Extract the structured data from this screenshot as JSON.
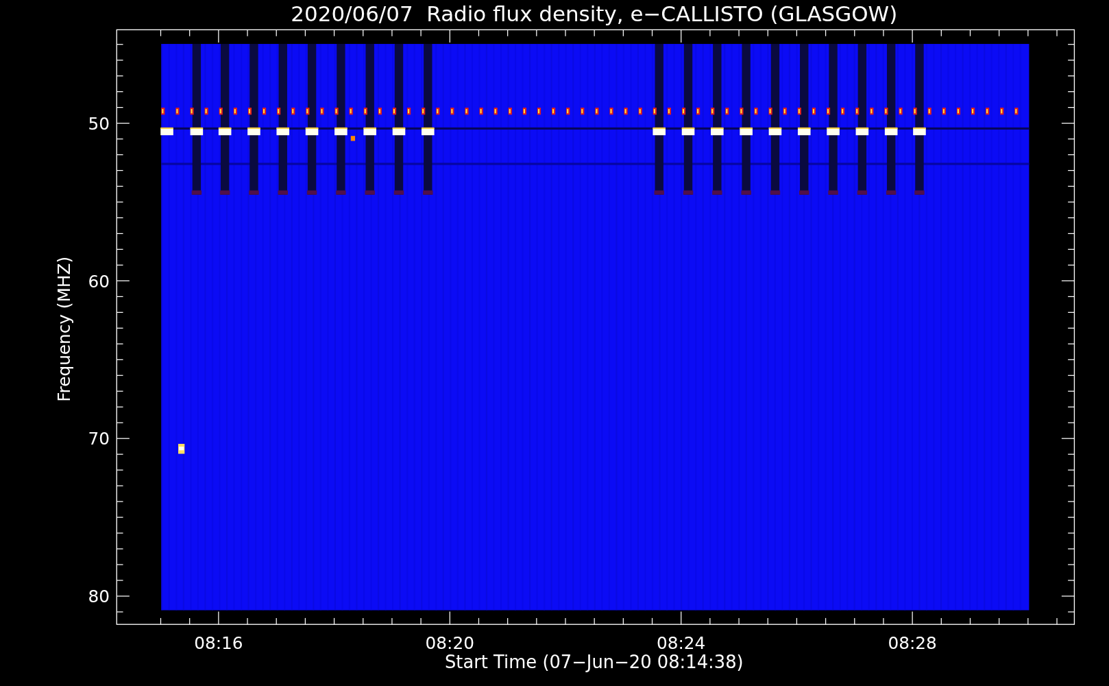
{
  "title": "2020/06/07  Radio flux density, e−CALLISTO (GLASGOW)",
  "x_axis": {
    "label": "Start Time (07−Jun−20 08:14:38)",
    "tick_labels": [
      "08:16",
      "08:20",
      "08:24",
      "08:28"
    ]
  },
  "y_axis": {
    "label": "Frequency (MHZ)",
    "tick_labels": [
      "50",
      "60",
      "70",
      "80"
    ]
  }
}
